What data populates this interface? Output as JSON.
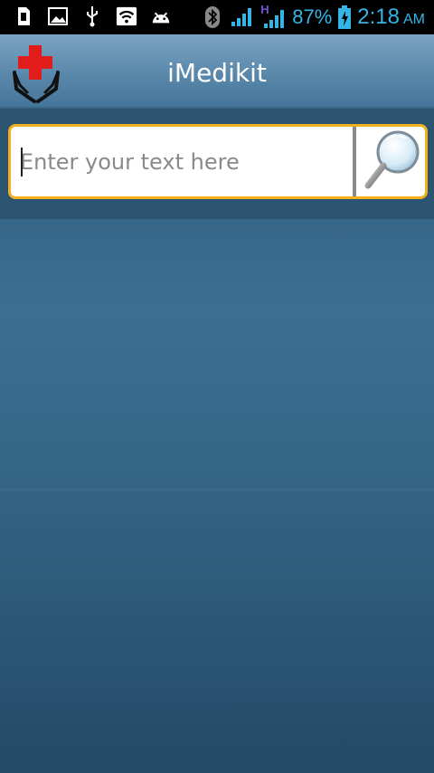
{
  "status_bar": {
    "battery_percent": "87%",
    "time": "2:18",
    "ampm": "AM",
    "network_type": "H",
    "icons_left": [
      "sd-card-icon",
      "image-icon",
      "usb-icon",
      "wifi-icon",
      "android-icon"
    ],
    "icons_right": [
      "bluetooth-icon",
      "signal-icon",
      "signal-h-icon",
      "battery-charging-icon"
    ],
    "accent": "#35b5e5"
  },
  "action_bar": {
    "title": "iMedikit",
    "logo_icon": "medical-cross-hands-icon",
    "logo_cross_color": "#e21b1b"
  },
  "search": {
    "placeholder": "Enter your text here",
    "value": "",
    "button_icon": "magnifier-icon",
    "border_color": "#f2b01f"
  }
}
